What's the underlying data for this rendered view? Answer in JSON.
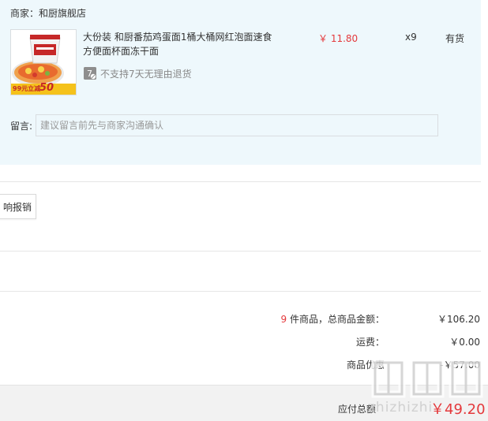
{
  "order": {
    "merchant": "商家：和厨旗舰店",
    "product": {
      "title": "大份装 和厨番茄鸡蛋面1桶大桶网红泡面速食方便面杯面冻干面",
      "price": "￥ 11.80",
      "quantity": "x9",
      "stock": "有货",
      "return_policy": "不支持7天无理由退货",
      "return_badge": "7",
      "promo_badge_text": "99元立减",
      "promo_badge_number": "50"
    },
    "note": {
      "label": "留言:",
      "placeholder": "建议留言前先与商家沟通确认"
    }
  },
  "receipt_button_label": "响报销",
  "summary": {
    "count": "9",
    "count_label": "件商品，总商品金额：",
    "total": "￥106.20",
    "shipping_label": "运费：",
    "shipping": "￥0.00",
    "discount_label": "商品优惠",
    "discount": "-￥57.00"
  },
  "footer": {
    "payable_label": "应付总额",
    "payable": "￥49.20"
  },
  "watermark": {
    "site_text": "zhizhizhi"
  },
  "colors": {
    "panel_bg": "#eef8fc",
    "price_red": "#e4393c",
    "footer_bg": "#f2f2f2"
  }
}
